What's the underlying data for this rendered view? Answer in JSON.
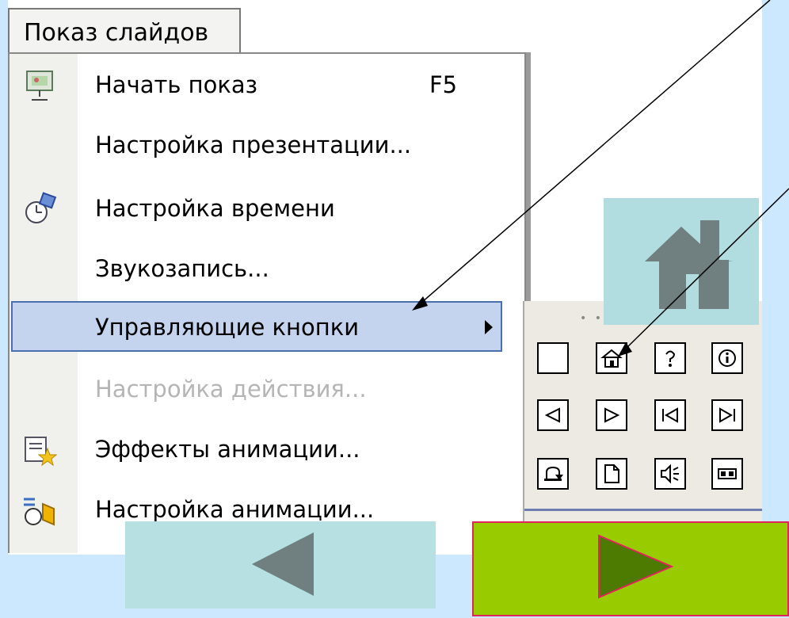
{
  "menu_title": "Показ слайдов",
  "menu_items": [
    {
      "label": "Начать показ",
      "shortcut": "F5",
      "icon": "slideshow-icon"
    },
    {
      "label": "Настройка презентации..."
    },
    {
      "label": "Настройка времени",
      "icon": "timer-icon"
    },
    {
      "label": "Звукозапись..."
    },
    {
      "label": "Управляющие кнопки",
      "submenu": true,
      "highlighted": true
    },
    {
      "label": "Настройка действия...",
      "disabled": true
    },
    {
      "label": "Эффекты анимации...",
      "icon": "animation-effects-icon"
    },
    {
      "label": "Настройка анимации...",
      "icon": "custom-animation-icon"
    }
  ],
  "action_buttons": [
    "custom-button-icon",
    "home-button-icon",
    "help-button-icon",
    "info-button-icon",
    "back-button-icon",
    "forward-button-icon",
    "beginning-button-icon",
    "end-button-icon",
    "return-button-icon",
    "document-button-icon",
    "sound-button-icon",
    "movie-button-icon"
  ],
  "colors": {
    "background": "#cce8ff",
    "highlight": "#c4d3ee",
    "nav_teal": "#b6e0e1",
    "nav_green": "#99cc00",
    "arrow_gray": "#708080",
    "arrow_green": "#4d7a00"
  }
}
